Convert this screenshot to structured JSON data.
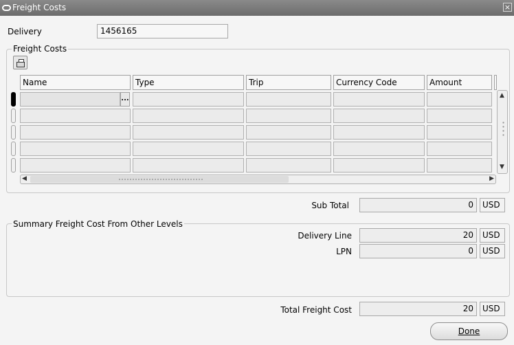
{
  "window": {
    "title": "Freight Costs",
    "close_glyph": "×"
  },
  "delivery": {
    "label": "Delivery",
    "value": "1456165"
  },
  "freight_group": {
    "title": "Freight Costs",
    "columns": [
      "Name",
      "Type",
      "Trip",
      "Currency Code",
      "Amount"
    ],
    "rows": [
      [
        "",
        "",
        "",
        "",
        ""
      ],
      [
        "",
        "",
        "",
        "",
        ""
      ],
      [
        "",
        "",
        "",
        "",
        ""
      ],
      [
        "",
        "",
        "",
        "",
        ""
      ],
      [
        "",
        "",
        "",
        "",
        ""
      ]
    ],
    "lov_glyph": "..."
  },
  "subtotal": {
    "label": "Sub Total",
    "value": "0",
    "currency": "USD"
  },
  "summary_group": {
    "title": "Summary Freight Cost From Other Levels",
    "delivery_line": {
      "label": "Delivery Line",
      "value": "20",
      "currency": "USD"
    },
    "lpn": {
      "label": "LPN",
      "value": "0",
      "currency": "USD"
    }
  },
  "total": {
    "label": "Total Freight Cost",
    "value": "20",
    "currency": "USD"
  },
  "done_button": {
    "label": "Done"
  },
  "icons": {
    "folder": "open-folder-icon",
    "close": "close-icon"
  }
}
